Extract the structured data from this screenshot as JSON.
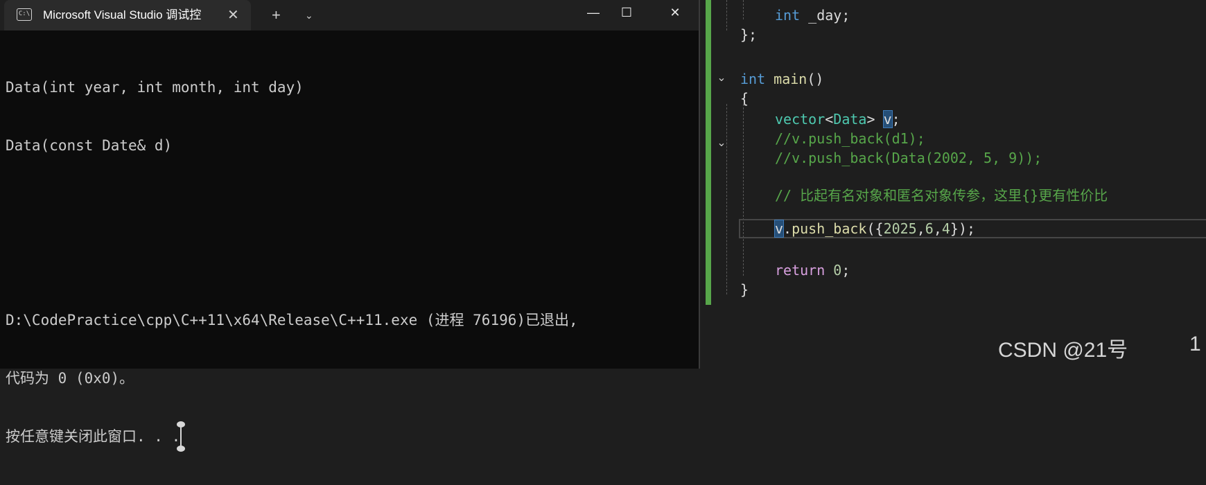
{
  "terminal": {
    "tab_title": "Microsoft Visual Studio 调试控",
    "tab_icon_glyph": "C:\\",
    "tab_close": "✕",
    "new_tab": "+",
    "dropdown": "⌄",
    "window_minimize": "—",
    "window_maximize": "☐",
    "window_close": "✕",
    "lines": [
      "Data(int year, int month, int day)",
      "Data(const Date& d)",
      "",
      "",
      "D:\\CodePractice\\cpp\\C++11\\x64\\Release\\C++11.exe (进程 76196)已退出,",
      "代码为 0 (0x0)。",
      "按任意键关闭此窗口. . ."
    ]
  },
  "editor": {
    "fold_icon": "⌄",
    "line_day_kw": "int",
    "line_day_rest": " _day;",
    "line_close_struct": "};",
    "main_kw": "int",
    "main_fn": "main",
    "main_paren": "()",
    "brace_open": "{",
    "vector_type": "vector",
    "vector_lt": "<",
    "vector_arg": "Data",
    "vector_gt": ">",
    "vector_var": "v",
    "vector_semi": ";",
    "comment1": "//v.push_back(d1);",
    "comment2": "//v.push_back(Data(2002, 5, 9));",
    "comment3": "// 比起有名对象和匿名对象传参，这里{}更有性价比",
    "push_var": "v",
    "push_dot": ".",
    "push_fn": "push_back",
    "push_open": "({",
    "push_n1": "2025",
    "push_c1": ",",
    "push_n2": "6",
    "push_c2": ",",
    "push_n3": "4",
    "push_close": "});",
    "return_kw": "return",
    "return_val": "0",
    "return_semi": ";",
    "brace_close": "}"
  },
  "watermark": "CSDN @21号",
  "corner_digit": "1"
}
